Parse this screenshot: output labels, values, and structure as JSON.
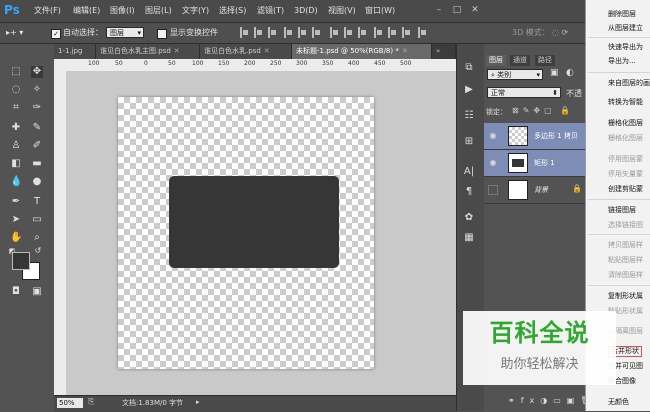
{
  "app": {
    "logo": "Ps"
  },
  "menu": [
    "文件(F)",
    "编辑(E)",
    "图像(I)",
    "图层(L)",
    "文字(Y)",
    "选择(S)",
    "滤镜(T)",
    "3D(D)",
    "视图(V)",
    "窗口(W)"
  ],
  "options": {
    "auto_select_label": "自动选择：",
    "auto_select_value": "图层",
    "show_transform_label": "显示变换控件",
    "mode_3d_label": "3D 模式："
  },
  "tabs": [
    {
      "label": "1-1.jpg"
    },
    {
      "label": "谁见白色水乳主图.psd"
    },
    {
      "label": "谁见白色水乳.psd"
    },
    {
      "label": "未标题-1.psd @ 50%(RGB/8) *"
    }
  ],
  "ruler_h": [
    "100",
    "50",
    "0",
    "50",
    "100",
    "150",
    "200",
    "250",
    "300",
    "350",
    "400",
    "450",
    "500"
  ],
  "status": {
    "zoom": "50%",
    "doc_info": "文档:1.83M/0 字节"
  },
  "panel": {
    "tabs": [
      "图层",
      "通道",
      "路径"
    ],
    "kind_filter": "类别",
    "blend_mode": "正常",
    "opacity_label": "不透",
    "lock_label": "锁定："
  },
  "layers": [
    {
      "name": "多边形 1 拷贝",
      "selected": true
    },
    {
      "name": "矩形 1",
      "selected": true
    },
    {
      "name": "背景",
      "selected": false
    }
  ],
  "context_menu": {
    "items": [
      {
        "label": "删除图层",
        "disabled": false
      },
      {
        "label": "从图层建立",
        "disabled": false
      },
      {
        "label": "快速导出为",
        "disabled": false
      },
      {
        "label": "导出为...",
        "disabled": false
      },
      {
        "label": "来自图层的画",
        "disabled": false
      },
      {
        "label": "转换为智能",
        "disabled": false
      },
      {
        "label": "栅格化图层",
        "disabled": false
      },
      {
        "label": "栅格化图层",
        "disabled": true
      },
      {
        "label": "停用图层蒙",
        "disabled": true
      },
      {
        "label": "停用矢量蒙",
        "disabled": true
      },
      {
        "label": "创建剪贴蒙",
        "disabled": false
      },
      {
        "label": "链接图层",
        "disabled": false
      },
      {
        "label": "选择链接图",
        "disabled": true
      },
      {
        "label": "拷贝图层样",
        "disabled": true
      },
      {
        "label": "粘贴图层样",
        "disabled": true
      },
      {
        "label": "清除图层样",
        "disabled": true
      },
      {
        "label": "复制形状属",
        "disabled": false
      },
      {
        "label": "粘贴形状属",
        "disabled": true
      },
      {
        "label": "从隔离图层",
        "disabled": true
      },
      {
        "label": "合并形状",
        "disabled": false
      },
      {
        "label": "合并可见图",
        "disabled": false
      },
      {
        "label": "拼合图像",
        "disabled": false
      },
      {
        "label": "无颜色",
        "disabled": false
      }
    ]
  },
  "watermark": {
    "title": "百科全说",
    "subtitle": "助你轻松解决"
  },
  "colors": {
    "accent": "#31a8ff",
    "shape_fill": "#363636",
    "selected_layer": "#7d8db5",
    "watermark_green": "#2fa82f"
  }
}
